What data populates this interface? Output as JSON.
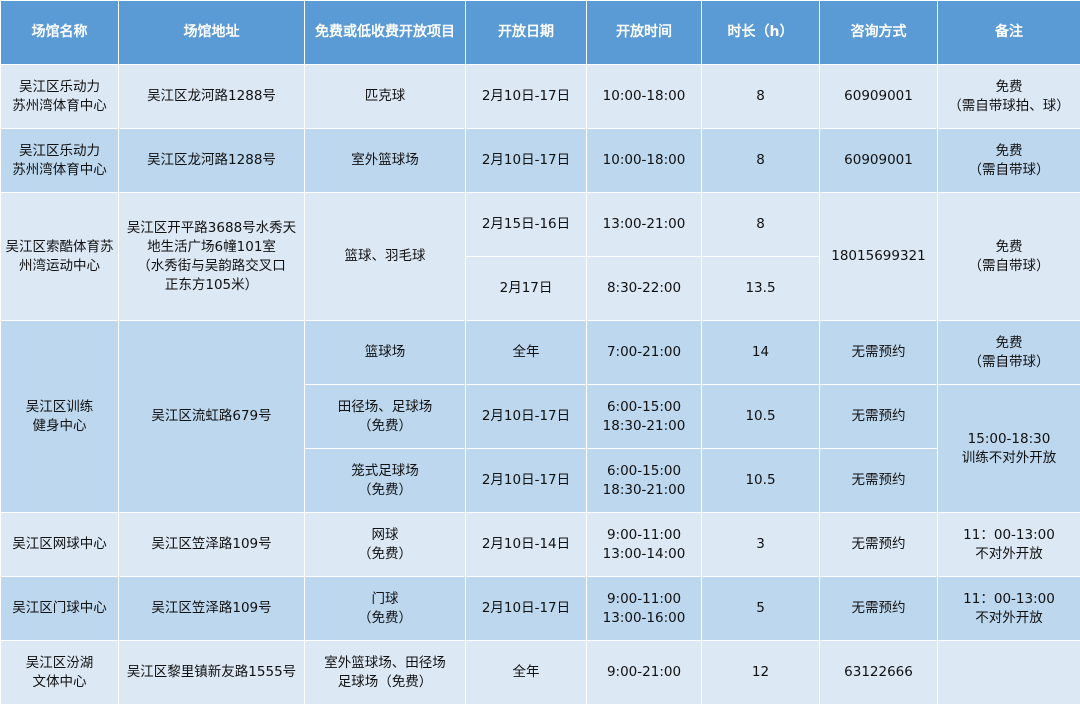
{
  "headers": [
    "场馆名称",
    "场馆地址",
    "免费或低收费开放项目",
    "开放日期",
    "开放时间",
    "时长（h）",
    "咨询方式",
    "备注"
  ],
  "rows": [
    {
      "name": "吴江区乐动力\n苏州湾体育中心",
      "address": "吴江区龙河路1288号",
      "item": "匹克球",
      "date": "2月10日-17日",
      "time": "10:00-18:00",
      "hours": "8",
      "contact": "60909001",
      "note": "免费\n（需自带球拍、球）"
    },
    {
      "name": "吴江区乐动力\n苏州湾体育中心",
      "address": "吴江区龙河路1288号",
      "item": "室外篮球场",
      "date": "2月10日-17日",
      "time": "10:00-18:00",
      "hours": "8",
      "contact": "60909001",
      "note": "免费\n（需自带球）"
    },
    {
      "name": "吴江区索酷体育苏\n州湾运动中心",
      "address": "吴江区开平路3688号水秀天\n地生活广场6幢101室\n（水秀街与吴韵路交叉口\n正东方105米）",
      "item": "篮球、羽毛球",
      "contact": "18015699321",
      "note": "免费\n（需自带球）",
      "sub": [
        {
          "date": "2月15日-16日",
          "time": "13:00-21:00",
          "hours": "8"
        },
        {
          "date": "2月17日",
          "time": "8:30-22:00",
          "hours": "13.5"
        }
      ]
    },
    {
      "name": "吴江区训练\n健身中心",
      "address": "吴江区流虹路679号",
      "sub": [
        {
          "item": "篮球场",
          "date": "全年",
          "time": "7:00-21:00",
          "hours": "14",
          "contact": "无需预约",
          "note": "免费\n（需自带球）"
        },
        {
          "item": "田径场、足球场\n（免费）",
          "date": "2月10日-17日",
          "time": "6:00-15:00\n18:30-21:00",
          "hours": "10.5",
          "contact": "无需预约",
          "note": "15:00-18:30\n训练不对外开放"
        },
        {
          "item": "笼式足球场\n（免费）",
          "date": "2月10日-17日",
          "time": "6:00-15:00\n18:30-21:00",
          "hours": "10.5",
          "contact": "无需预约"
        }
      ]
    },
    {
      "name": "吴江区网球中心",
      "address": "吴江区笠泽路109号",
      "item": "网球\n（免费）",
      "date": "2月10日-14日",
      "time": "9:00-11:00\n13:00-14:00",
      "hours": "3",
      "contact": "无需预约",
      "note": "11：00-13:00\n不对外开放"
    },
    {
      "name": "吴江区门球中心",
      "address": "吴江区笠泽路109号",
      "item": "门球\n（免费）",
      "date": "2月10日-17日",
      "time": "9:00-11:00\n13:00-16:00",
      "hours": "5",
      "contact": "无需预约",
      "note": "11：00-13:00\n不对外开放"
    },
    {
      "name": "吴江区汾湖\n文体中心",
      "address": "吴江区黎里镇新友路1555号",
      "item": "室外篮球场、田径场\n足球场（免费）",
      "date": "全年",
      "time": "9:00-21:00",
      "hours": "12",
      "contact": "63122666",
      "note": ""
    }
  ]
}
